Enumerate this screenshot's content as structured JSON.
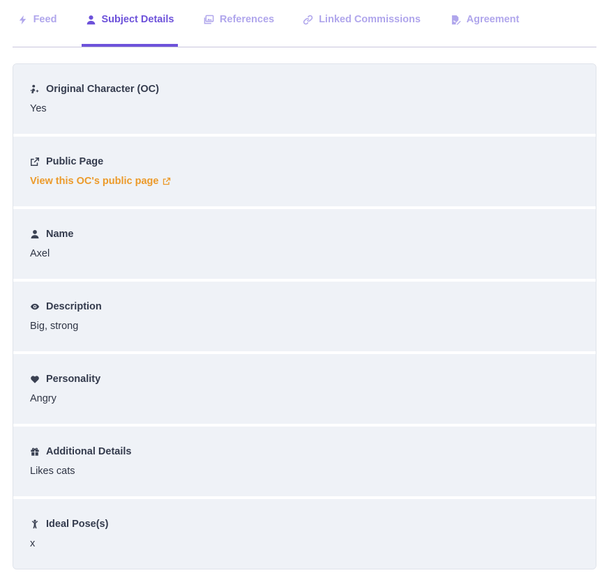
{
  "tabs": [
    {
      "label": "Feed",
      "icon": "bolt-icon",
      "active": false
    },
    {
      "label": "Subject Details",
      "icon": "user-icon",
      "active": true
    },
    {
      "label": "References",
      "icon": "images-icon",
      "active": false
    },
    {
      "label": "Linked Commissions",
      "icon": "link-icon",
      "active": false
    },
    {
      "label": "Agreement",
      "icon": "signed-document-icon",
      "active": false
    }
  ],
  "colors": {
    "accent": "#6d52da",
    "tab_inactive": "#b0a6ec",
    "link": "#ec9a2a",
    "section_bg": "#eff2f7"
  },
  "sections": {
    "oc": {
      "label": "Original Character (OC)",
      "value": "Yes",
      "icon": "person-sparkle-icon"
    },
    "public_page": {
      "label": "Public Page",
      "link_text": "View this OC's public page",
      "icon": "external-link-icon"
    },
    "name": {
      "label": "Name",
      "value": "Axel",
      "icon": "user-icon"
    },
    "description": {
      "label": "Description",
      "value": "Big, strong",
      "icon": "eye-icon"
    },
    "personality": {
      "label": "Personality",
      "value": "Angry",
      "icon": "heart-icon"
    },
    "additional": {
      "label": "Additional Details",
      "value": "Likes cats",
      "icon": "gift-icon"
    },
    "pose": {
      "label": "Ideal Pose(s)",
      "value": "x",
      "icon": "pose-figure-icon"
    }
  }
}
